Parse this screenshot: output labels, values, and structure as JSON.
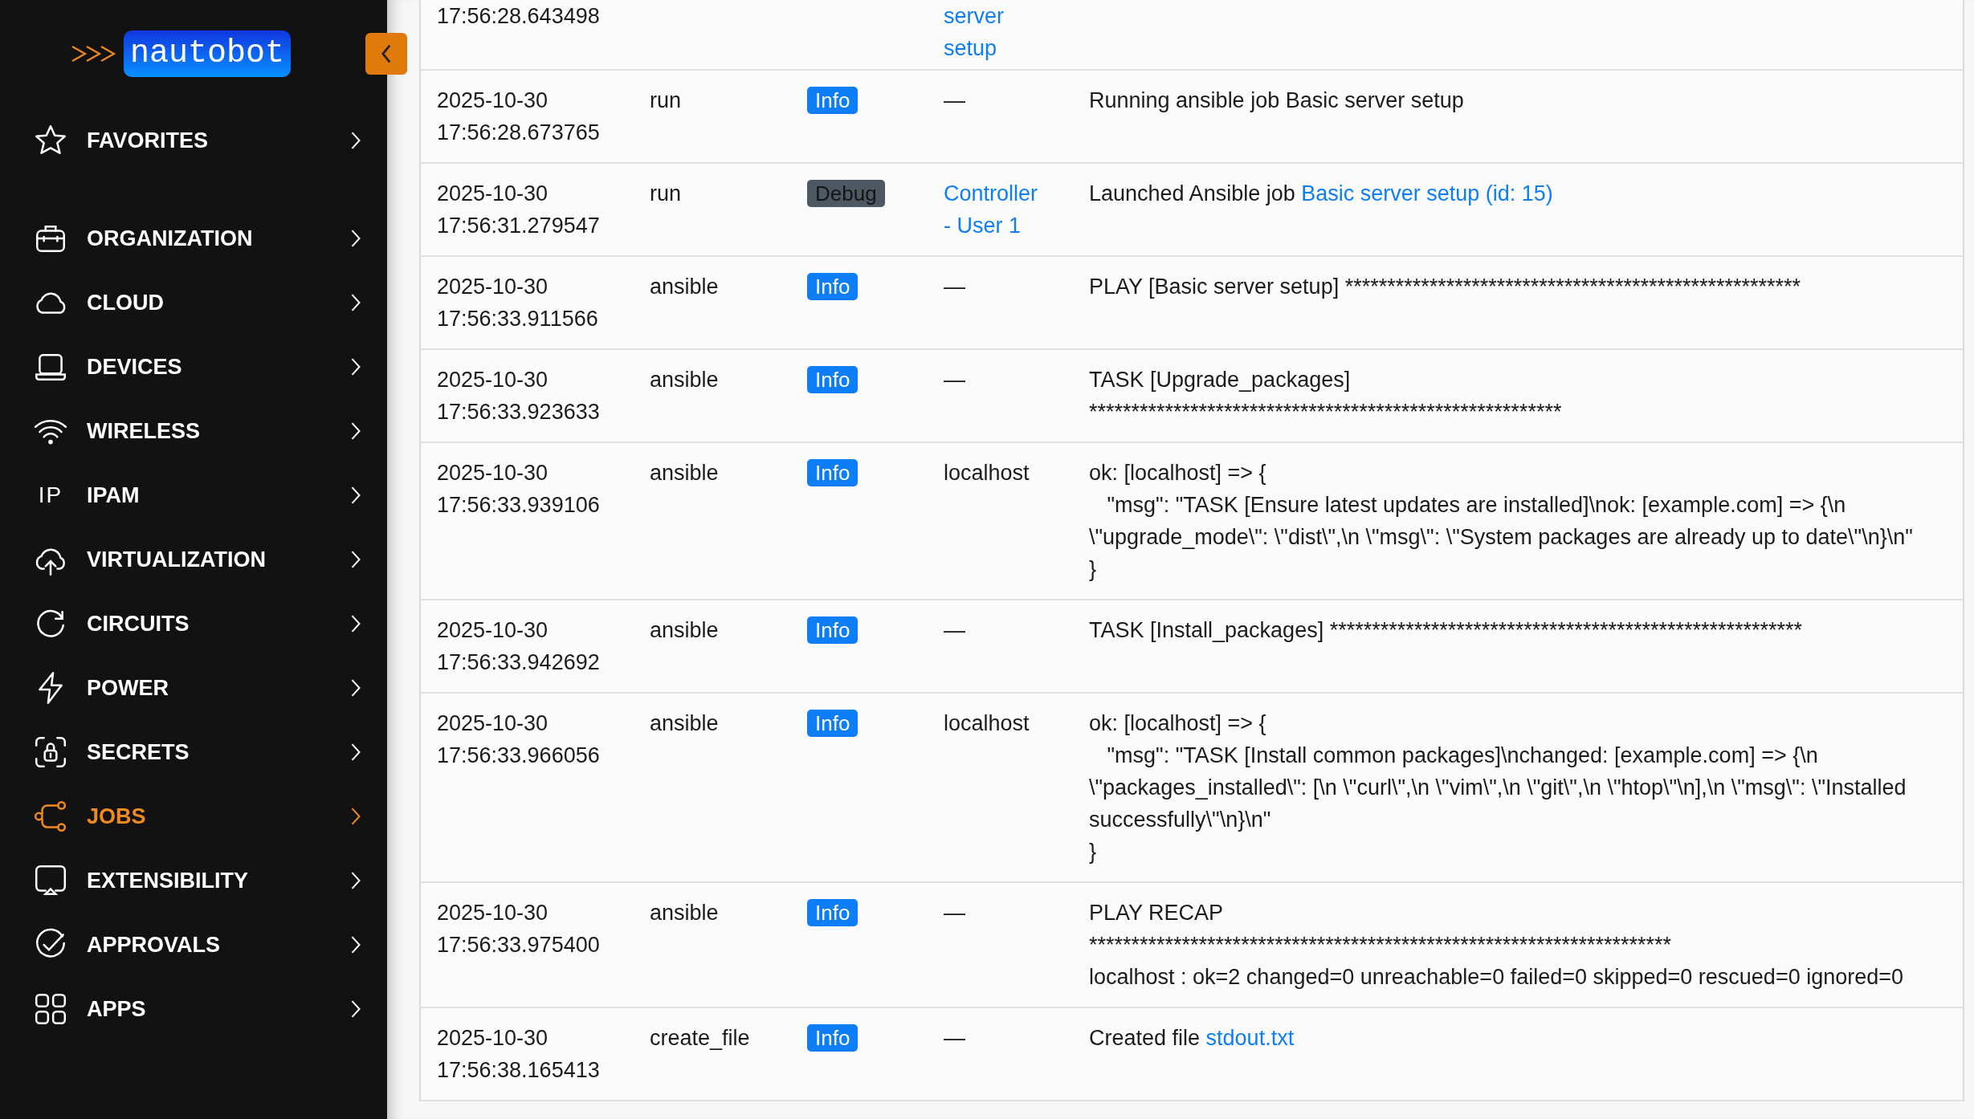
{
  "sidebar": {
    "logo": {
      "text": "nautobot"
    },
    "items": [
      {
        "label": "FAVORITES",
        "selected": false
      },
      {
        "label": "ORGANIZATION",
        "selected": false
      },
      {
        "label": "CLOUD",
        "selected": false
      },
      {
        "label": "DEVICES",
        "selected": false
      },
      {
        "label": "WIRELESS",
        "selected": false
      },
      {
        "label": "IPAM",
        "selected": false,
        "icon_text": "IP"
      },
      {
        "label": "VIRTUALIZATION",
        "selected": false
      },
      {
        "label": "CIRCUITS",
        "selected": false
      },
      {
        "label": "POWER",
        "selected": false
      },
      {
        "label": "SECRETS",
        "selected": false
      },
      {
        "label": "JOBS",
        "selected": true
      },
      {
        "label": "EXTENSIBILITY",
        "selected": false
      },
      {
        "label": "APPROVALS",
        "selected": false
      },
      {
        "label": "APPS",
        "selected": false
      }
    ]
  },
  "log_table": {
    "rows": [
      {
        "time": "17:56:28.643498",
        "object": {
          "kind": "link",
          "text": "server setup"
        }
      },
      {
        "time": "2025-10-30 17:56:28.673765",
        "grouping": "run",
        "badge": {
          "kind": "info",
          "text": "Info"
        },
        "object": {
          "kind": "text",
          "text": "—"
        },
        "message": {
          "text": "Running ansible job Basic server setup"
        }
      },
      {
        "time": "2025-10-30 17:56:31.279547",
        "grouping": "run",
        "badge": {
          "kind": "debug",
          "text": "Debug"
        },
        "object": {
          "kind": "link",
          "text": "Controller - User 1"
        },
        "message": {
          "text": "Launched Ansible job ",
          "link": "Basic server setup (id: 15)"
        }
      },
      {
        "time": "2025-10-30 17:56:33.911566",
        "grouping": "ansible",
        "badge": {
          "kind": "info",
          "text": "Info"
        },
        "object": {
          "kind": "text",
          "text": "—"
        },
        "message": {
          "text": "PLAY [Basic server setup] ******************************************************"
        }
      },
      {
        "time": "2025-10-30 17:56:33.923633",
        "grouping": "ansible",
        "badge": {
          "kind": "info",
          "text": "Info"
        },
        "object": {
          "kind": "text",
          "text": "—"
        },
        "message": {
          "text": "TASK [Upgrade_packages]\n********************************************************"
        }
      },
      {
        "time": "2025-10-30 17:56:33.939106",
        "grouping": "ansible",
        "badge": {
          "kind": "info",
          "text": "Info"
        },
        "object": {
          "kind": "text",
          "text": "localhost"
        },
        "message": {
          "text": "ok: [localhost] => {\n   \"msg\": \"TASK [Ensure latest updates are installed]\\nok: [example.com] => {\\n \\\"upgrade_mode\\\": \\\"dist\\\",\\n \\\"msg\\\": \\\"System packages are already up to date\\\"\\n}\\n\"\n}"
        }
      },
      {
        "time": "2025-10-30 17:56:33.942692",
        "grouping": "ansible",
        "badge": {
          "kind": "info",
          "text": "Info"
        },
        "object": {
          "kind": "text",
          "text": "—"
        },
        "message": {
          "text": "TASK [Install_packages] ********************************************************"
        }
      },
      {
        "time": "2025-10-30 17:56:33.966056",
        "grouping": "ansible",
        "badge": {
          "kind": "info",
          "text": "Info"
        },
        "object": {
          "kind": "text",
          "text": "localhost"
        },
        "message": {
          "text": "ok: [localhost] => {\n   \"msg\": \"TASK [Install common packages]\\nchanged: [example.com] => {\\n \\\"packages_installed\\\": [\\n \\\"curl\\\",\\n \\\"vim\\\",\\n \\\"git\\\",\\n \\\"htop\\\"\\n],\\n \\\"msg\\\": \\\"Installed successfully\\\"\\n}\\n\"\n}"
        }
      },
      {
        "time": "2025-10-30 17:56:33.975400",
        "grouping": "ansible",
        "badge": {
          "kind": "info",
          "text": "Info"
        },
        "object": {
          "kind": "text",
          "text": "—"
        },
        "message": {
          "text": "PLAY RECAP\n*********************************************************************\nlocalhost : ok=2 changed=0 unreachable=0 failed=0 skipped=0 rescued=0 ignored=0"
        }
      },
      {
        "time": "2025-10-30 17:56:38.165413",
        "grouping": "create_file",
        "badge": {
          "kind": "info",
          "text": "Info"
        },
        "object": {
          "kind": "text",
          "text": "—"
        },
        "message": {
          "text": "Created file ",
          "link": "stdout.txt"
        }
      }
    ]
  }
}
